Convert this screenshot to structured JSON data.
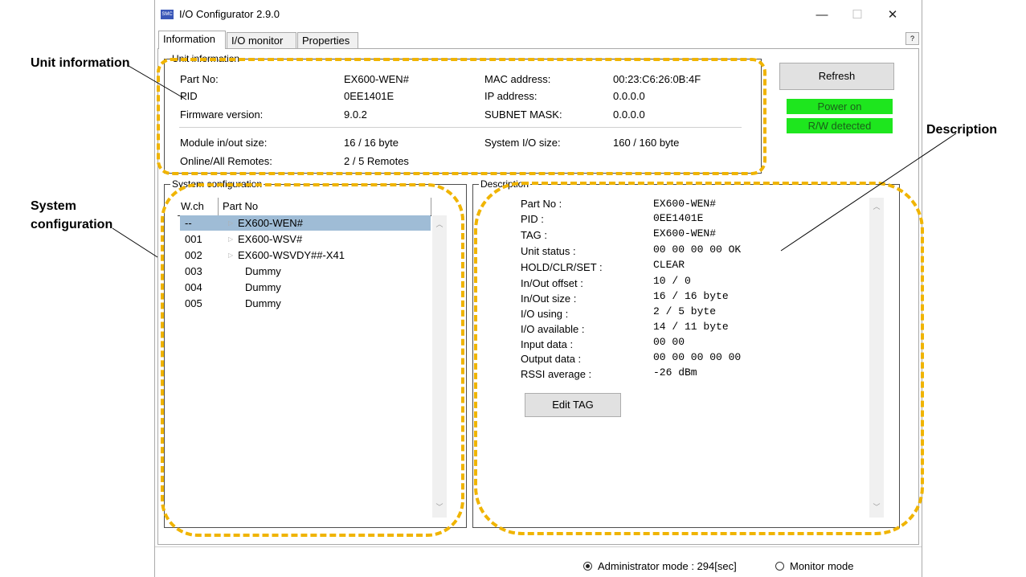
{
  "window": {
    "title": "I/O Configurator 2.9.0",
    "app_icon_text": "SMC",
    "minimize": "—",
    "maximize": "☐",
    "close": "✕",
    "help": "?"
  },
  "tabs": [
    {
      "label": "Information",
      "active": true
    },
    {
      "label": "I/O monitor",
      "active": false
    },
    {
      "label": "Properties",
      "active": false
    }
  ],
  "unit_info": {
    "legend": "Unit information",
    "part_no_label": "Part No:",
    "part_no_value": "EX600-WEN#",
    "pid_label": "PID",
    "pid_value": "0EE1401E",
    "fw_label": "Firmware version:",
    "fw_value": "9.0.2",
    "mac_label": "MAC address:",
    "mac_value": "00:23:C6:26:0B:4F",
    "ip_label": "IP address:",
    "ip_value": "0.0.0.0",
    "subnet_label": "SUBNET MASK:",
    "subnet_value": "0.0.0.0",
    "module_size_label": "Module in/out size:",
    "module_size_value": "16 / 16 byte",
    "sys_io_label": "System I/O size:",
    "sys_io_value": "160 / 160 byte",
    "online_label": "Online/All Remotes:",
    "online_value": "2 / 5 Remotes"
  },
  "side": {
    "refresh_label": "Refresh",
    "power_on": "Power on",
    "rw_detected": "R/W detected",
    "status_color": "#1ee61e"
  },
  "system_config": {
    "legend": "System configuration",
    "col_wch": "W.ch",
    "col_partno": "Part No",
    "rows": [
      {
        "wch": "--",
        "part": "EX600-WEN#",
        "expandable": true,
        "selected": true
      },
      {
        "wch": "001",
        "part": "EX600-WSV#",
        "expandable": true,
        "selected": false
      },
      {
        "wch": "002",
        "part": "EX600-WSVDY##-X41",
        "expandable": true,
        "selected": false
      },
      {
        "wch": "003",
        "part": "Dummy",
        "expandable": false,
        "selected": false
      },
      {
        "wch": "004",
        "part": "Dummy",
        "expandable": false,
        "selected": false
      },
      {
        "wch": "005",
        "part": "Dummy",
        "expandable": false,
        "selected": false
      }
    ]
  },
  "description": {
    "legend": "Description",
    "items": [
      {
        "label": "Part No :",
        "value": "EX600-WEN#"
      },
      {
        "label": "PID :",
        "value": "0EE1401E"
      },
      {
        "label": "TAG :",
        "value": "EX600-WEN#"
      },
      {
        "label": "Unit status :",
        "value": "00 00 00 00 OK"
      },
      {
        "label": "HOLD/CLR/SET :",
        "value": "CLEAR"
      },
      {
        "label": "In/Out offset :",
        "value": "10 / 0"
      },
      {
        "label": "In/Out size :",
        "value": "16 / 16 byte"
      },
      {
        "label": "I/O using :",
        "value": "2 / 5 byte"
      },
      {
        "label": "I/O available :",
        "value": "14 / 11 byte"
      },
      {
        "label": "Input data :",
        "value": "00 00"
      },
      {
        "label": "Output data :",
        "value": "00 00 00 00 00"
      },
      {
        "label": "RSSI average :",
        "value": "-26 dBm"
      }
    ],
    "edit_tag_label": "Edit TAG"
  },
  "footer": {
    "admin_mode": "Administrator mode : 294[sec]",
    "monitor_mode": "Monitor mode",
    "admin_selected": true
  },
  "annotations": {
    "unit_information": "Unit information",
    "system_configuration_line1": "System",
    "system_configuration_line2": "configuration",
    "description": "Description",
    "highlight_color": "#f0b400"
  }
}
